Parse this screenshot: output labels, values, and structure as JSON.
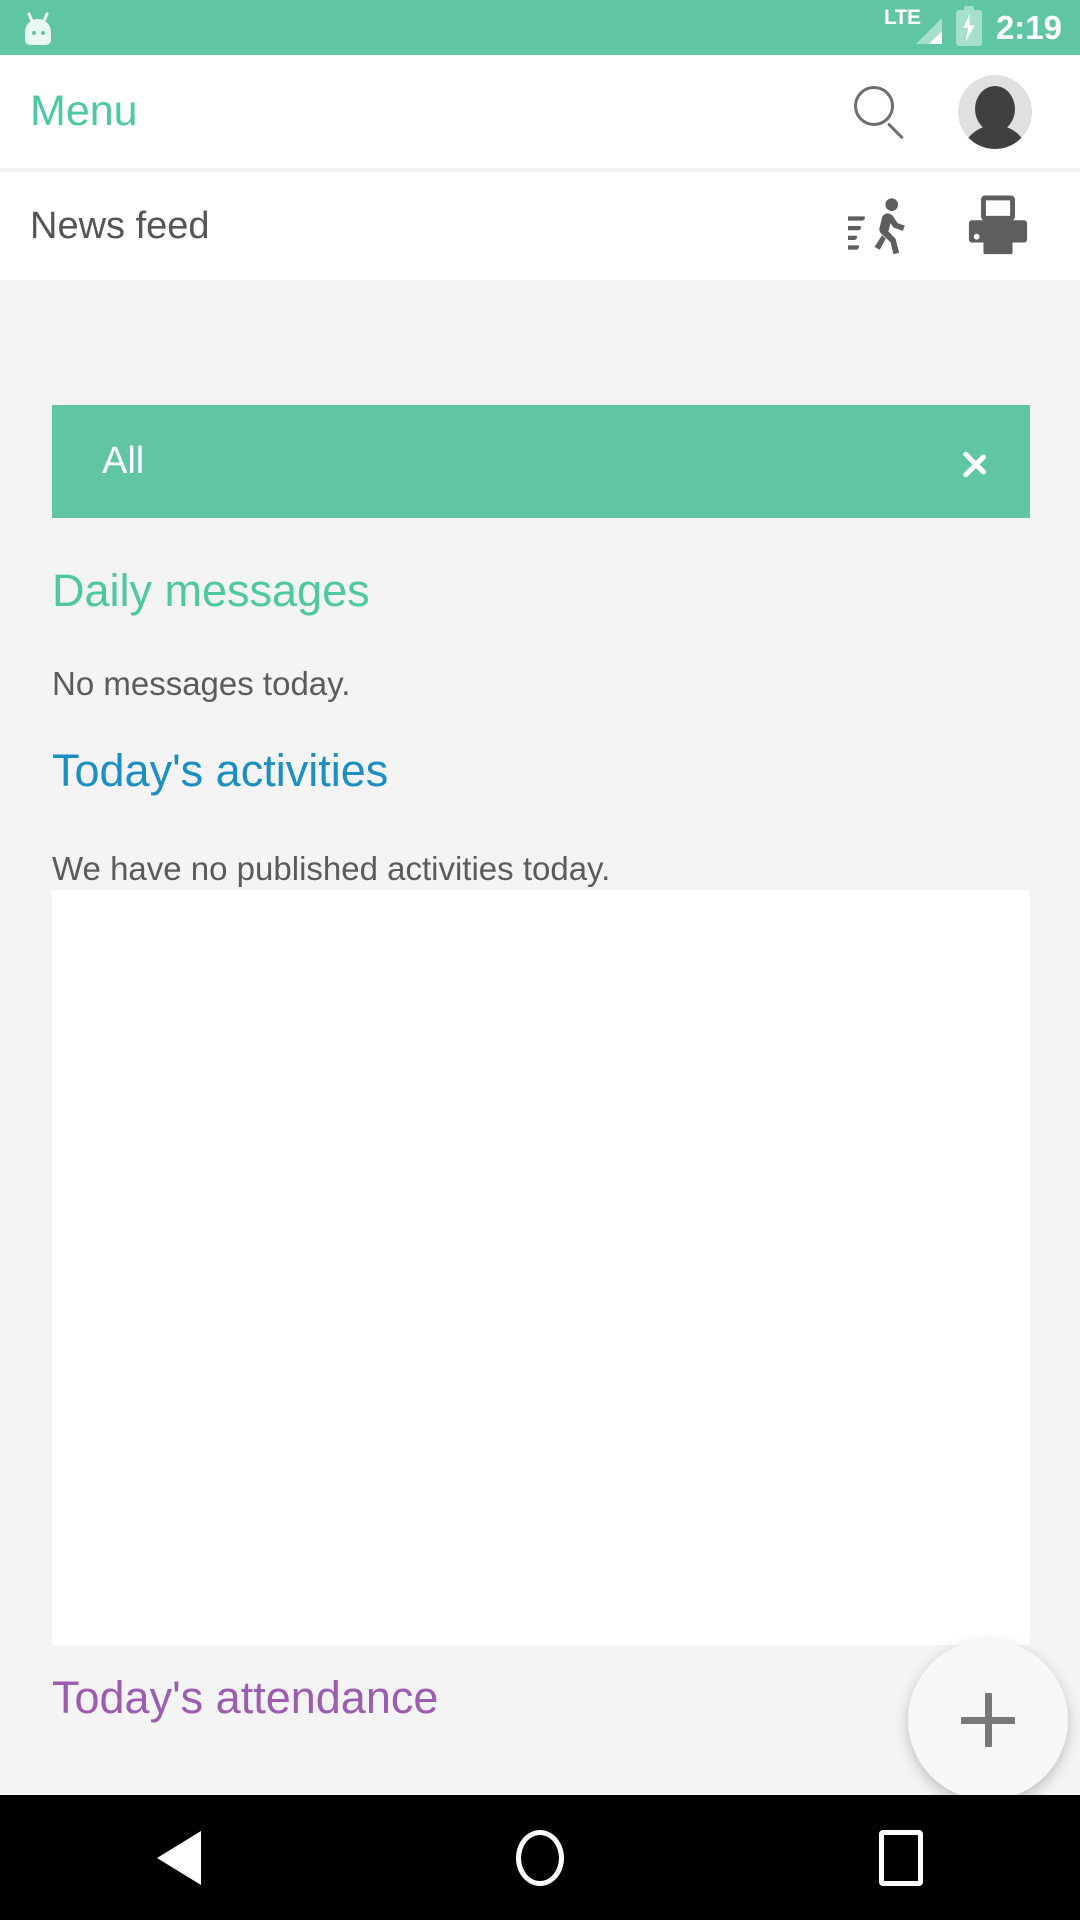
{
  "status_bar": {
    "logo_icon": "android-head-icon",
    "network_label": "LTE",
    "signal_icon": "signal-bars-icon",
    "battery_icon": "battery-charging-icon",
    "time": "2:19",
    "background_color": "#5fc5a5"
  },
  "app_bar": {
    "title": "Menu",
    "title_color": "#4ec8a0",
    "search_icon": "search-icon",
    "avatar_icon": "avatar-icon"
  },
  "sub_header": {
    "title": "News feed",
    "run_icon": "running-person-icon",
    "print_icon": "printer-icon"
  },
  "filter": {
    "label": "All",
    "chevron_icon": "chevron-right-icon",
    "background_color": "#5fc5a5"
  },
  "sections": [
    {
      "title": "Daily messages",
      "title_color": "#4ec8a0",
      "body": "No messages today."
    },
    {
      "title": "Today's activities",
      "title_color": "#1b8fc4",
      "body": "We have no published activities today."
    },
    {
      "title": "Today's attendance",
      "title_color": "#9c5cb0",
      "body": ""
    }
  ],
  "fab": {
    "icon": "plus-icon",
    "label": "Add"
  },
  "nav_bar": {
    "back_icon": "back-triangle-icon",
    "home_icon": "home-circle-icon",
    "recents_icon": "recents-square-icon"
  }
}
